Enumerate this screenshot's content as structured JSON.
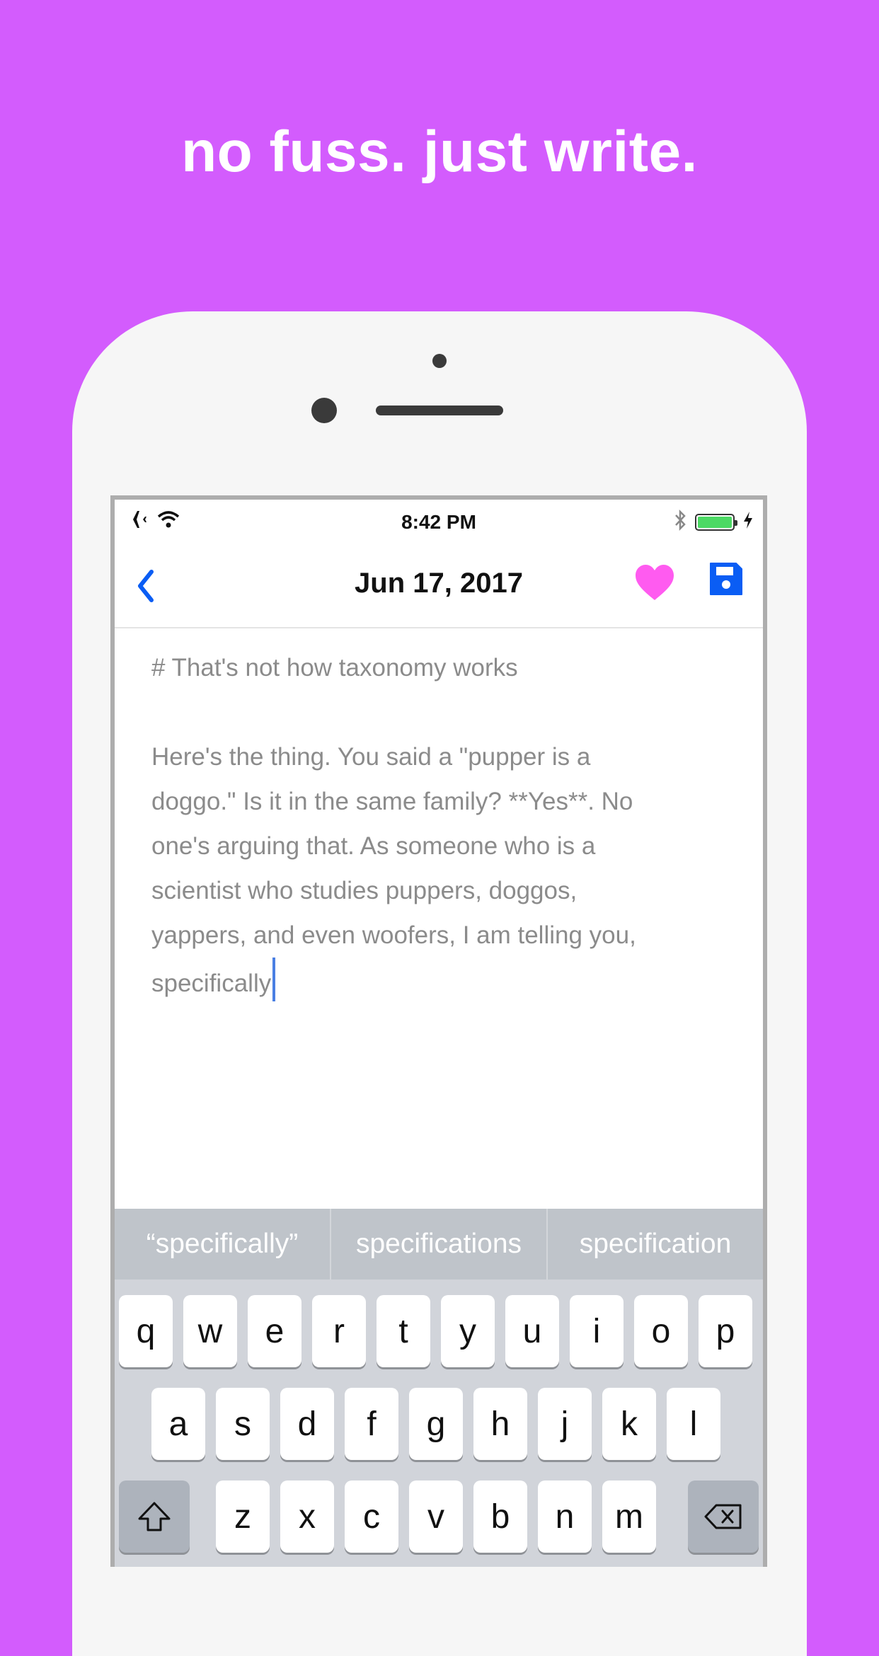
{
  "headline": "no fuss. just write.",
  "status_bar": {
    "time": "8:42 PM",
    "battery_color": "#4cd964"
  },
  "nav": {
    "title": "Jun 17, 2017",
    "back_icon": "chevron-left-icon",
    "favorite_icon": "heart-icon",
    "favorite_color": "#ff5bf0",
    "save_icon": "floppy-disk-icon",
    "accent_color": "#0a5df4"
  },
  "editor": {
    "heading_line": "# That's not how taxonomy works",
    "body_lines": [
      "Here's the thing. You said a \"pupper is a",
      "doggo.\" Is it in the same family? **Yes**. No",
      "one's arguing that. As someone who is a",
      "scientist who studies puppers, doggos,",
      "yappers, and even woofers, I am telling you,",
      "specifically"
    ]
  },
  "suggestions": [
    "“specifically”",
    "specifications",
    "specification"
  ],
  "keyboard": {
    "row1": [
      "q",
      "w",
      "e",
      "r",
      "t",
      "y",
      "u",
      "i",
      "o",
      "p"
    ],
    "row2": [
      "a",
      "s",
      "d",
      "f",
      "g",
      "h",
      "j",
      "k",
      "l"
    ],
    "row3": [
      "z",
      "x",
      "c",
      "v",
      "b",
      "n",
      "m"
    ],
    "shift_icon": "shift-icon",
    "delete_icon": "backspace-icon"
  }
}
